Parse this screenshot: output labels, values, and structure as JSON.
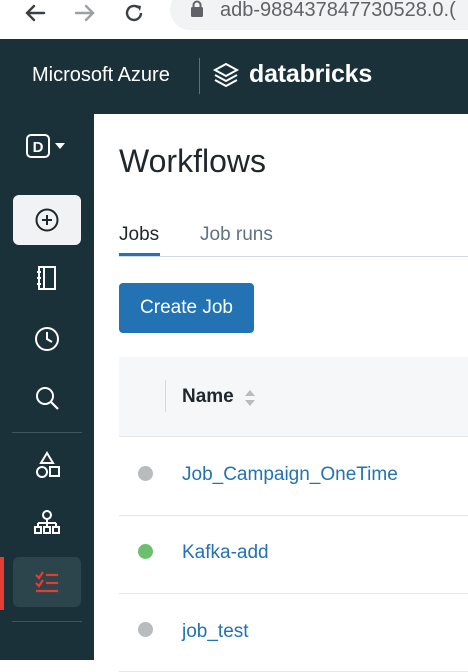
{
  "browser": {
    "back_icon": "back-arrow-icon",
    "forward_icon": "forward-arrow-icon",
    "reload_icon": "reload-icon",
    "url": "adb-9884378477305 28.0.",
    "url_display": "adb-988437847730528.0.("
  },
  "header": {
    "brand": "Microsoft Azure",
    "product": "databricks"
  },
  "sidebar": {
    "workspace_letter": "D",
    "items": [
      {
        "icon": "plus-circle-icon",
        "active": false,
        "highlighted": true
      },
      {
        "icon": "notebook-icon"
      },
      {
        "icon": "clock-icon"
      },
      {
        "icon": "search-icon"
      },
      {
        "icon": "shapes-icon"
      },
      {
        "icon": "hierarchy-icon"
      },
      {
        "icon": "checklist-icon",
        "active": true
      }
    ]
  },
  "page": {
    "title": "Workflows",
    "tabs": [
      {
        "label": "Jobs",
        "selected": true
      },
      {
        "label": "Job runs",
        "selected": false
      }
    ],
    "create_button": "Create Job"
  },
  "table": {
    "columns": [
      {
        "label": "Name",
        "sortable": true
      }
    ],
    "rows": [
      {
        "name": "Job_Campaign_OneTime",
        "status_color": "#b8bcbf"
      },
      {
        "name": "Kafka-add",
        "status_color": "#6cbf6c"
      },
      {
        "name": "job_test",
        "status_color": "#b8bcbf"
      }
    ]
  },
  "colors": {
    "sidebar_bg": "#1b3139",
    "accent": "#2272b4",
    "active_indicator": "#e53e30"
  }
}
